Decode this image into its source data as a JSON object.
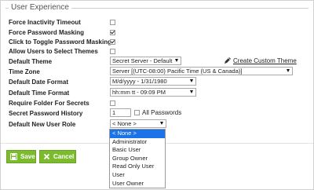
{
  "section": {
    "title": "User Experience"
  },
  "settings": {
    "force_inactivity_timeout": {
      "label": "Force Inactivity Timeout",
      "checked": false
    },
    "force_password_masking": {
      "label": "Force Password Masking",
      "checked": true
    },
    "click_toggle_masking": {
      "label": "Click to Toggle Password Masking",
      "checked": true
    },
    "allow_select_themes": {
      "label": "Allow Users to Select Themes",
      "checked": false
    },
    "default_theme": {
      "label": "Default Theme",
      "value": "Secret Server - Default",
      "link": "Create Custom Theme"
    },
    "time_zone": {
      "label": "Time Zone",
      "value": "Server [(UTC-08:00) Pacific Time (US & Canada)]"
    },
    "default_date_format": {
      "label": "Default Date Format",
      "value": "M/d/yyyy - 1/31/1980"
    },
    "default_time_format": {
      "label": "Default Time Format",
      "value": "hh:mm tt - 09:09 PM"
    },
    "require_folder": {
      "label": "Require Folder For Secrets",
      "checked": false
    },
    "secret_password_history": {
      "label": "Secret Password History",
      "value": "1",
      "all_label": "All Passwords"
    },
    "default_new_user_role": {
      "label": "Default New User Role",
      "value": "< None >",
      "options": [
        "< None >",
        "Administrator",
        "Basic User",
        "Group Owner",
        "Read Only User",
        "User",
        "User Owner"
      ]
    }
  },
  "buttons": {
    "save": "Save",
    "cancel": "Cancel"
  },
  "colors": {
    "button_green": "#7dbb2e",
    "selected_option": "#1a73e8"
  }
}
